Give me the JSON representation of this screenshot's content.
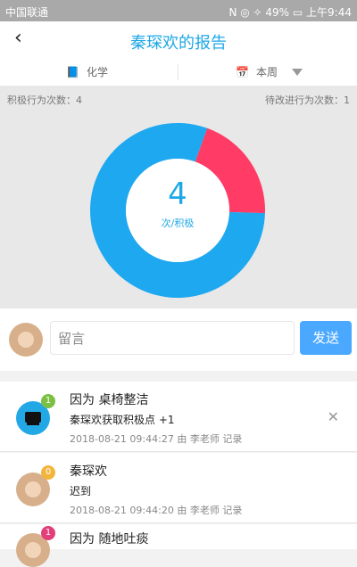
{
  "statusbar": {
    "carrier": "中国联通",
    "right": "N ◎ ✧ 49% ▭ 上午9:44"
  },
  "header": {
    "title": "秦琛欢的报告",
    "back": "‹"
  },
  "filters": {
    "subject": "化学",
    "period": "本周"
  },
  "stats": {
    "positive_label": "积极行为次数：4",
    "pending_label": "待改进行为次数：1"
  },
  "chart_data": {
    "type": "pie",
    "series": [
      {
        "value": 4,
        "color": "#1ea8f0"
      },
      {
        "value": 1,
        "color": "#ff3b66"
      }
    ],
    "center_value": "4",
    "center_label": "次/积极"
  },
  "message": {
    "placeholder": "留言",
    "send": "发送"
  },
  "records": [
    {
      "title": "因为 桌椅整洁",
      "desc": "秦琛欢获取积极点 +1",
      "meta": "2018-08-21 09:44:27 由 李老师 记录",
      "badge": "1",
      "badge_color": "green",
      "icon": "piano-icon"
    },
    {
      "title": "秦琛欢",
      "desc": "迟到",
      "meta": "2018-08-21 09:44:20 由 李老师 记录",
      "badge": "0",
      "badge_color": "yellow",
      "icon": "student-avatar"
    },
    {
      "title": "因为 随地吐痰",
      "badge": "1",
      "badge_color": "pink",
      "icon": "student-avatar"
    }
  ]
}
